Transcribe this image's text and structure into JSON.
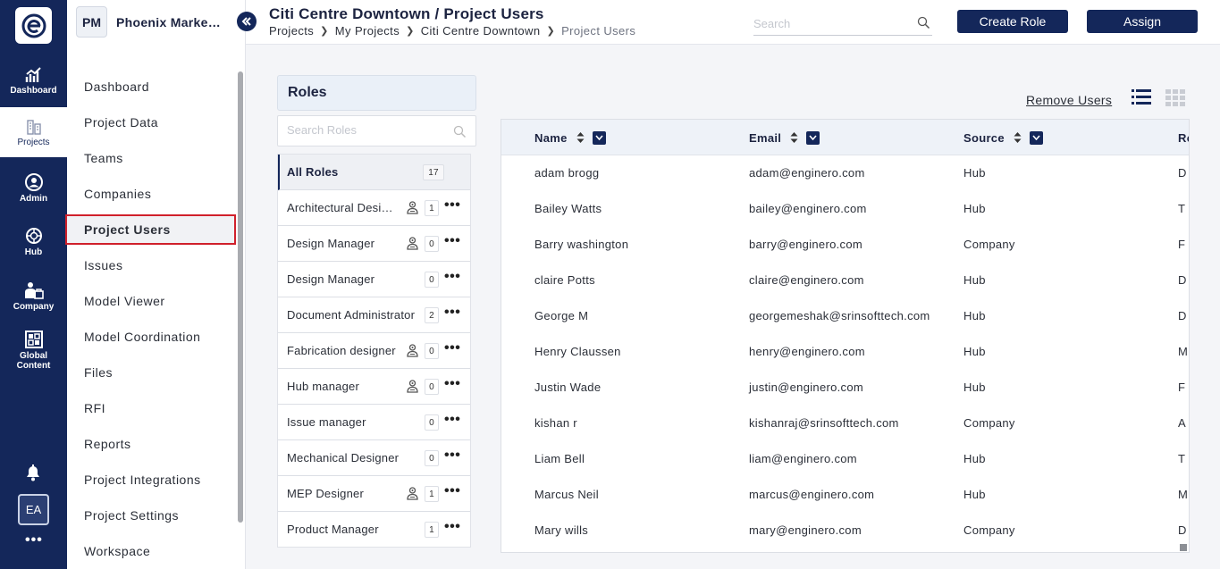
{
  "rail": {
    "items": [
      {
        "label": "Dashboard"
      },
      {
        "label": "Projects"
      },
      {
        "label": "Admin"
      },
      {
        "label": "Hub"
      },
      {
        "label": "Company"
      },
      {
        "label": "Global Content"
      }
    ],
    "avatar": "EA",
    "more": "•••"
  },
  "nav": {
    "project_initials": "PM",
    "project_name": "Phoenix Marketplace",
    "items": [
      {
        "label": "Dashboard"
      },
      {
        "label": "Project Data"
      },
      {
        "label": "Teams"
      },
      {
        "label": "Companies"
      },
      {
        "label": "Project Users"
      },
      {
        "label": "Issues"
      },
      {
        "label": "Model Viewer"
      },
      {
        "label": "Model Coordination"
      },
      {
        "label": "Files"
      },
      {
        "label": "RFI"
      },
      {
        "label": "Reports"
      },
      {
        "label": "Project Integrations"
      },
      {
        "label": "Project Settings"
      },
      {
        "label": "Workspace"
      }
    ]
  },
  "header": {
    "title": "Citi Centre Downtown / Project Users",
    "breadcrumbs": [
      "Projects",
      "My Projects",
      "Citi Centre Downtown",
      "Project Users"
    ],
    "search_placeholder": "Search",
    "create_role_label": "Create Role",
    "assign_label": "Assign"
  },
  "roles": {
    "title": "Roles",
    "search_placeholder": "Search Roles",
    "items": [
      {
        "name": "All Roles",
        "count": "17"
      },
      {
        "name": "Architectural Designer",
        "count": "1"
      },
      {
        "name": "Design Manager",
        "count": "0"
      },
      {
        "name": "Design Manager",
        "count": "0"
      },
      {
        "name": "Document Administrator",
        "count": "2"
      },
      {
        "name": "Fabrication designer",
        "count": "0"
      },
      {
        "name": "Hub manager",
        "count": "0"
      },
      {
        "name": "Issue manager",
        "count": "0"
      },
      {
        "name": "Mechanical Designer",
        "count": "0"
      },
      {
        "name": "MEP Designer",
        "count": "1"
      },
      {
        "name": "Product Manager",
        "count": "1"
      }
    ],
    "dots": "•••"
  },
  "users": {
    "remove_label": "Remove Users",
    "columns": [
      "Name",
      "Email",
      "Source",
      "Role"
    ],
    "rows": [
      {
        "name": "adam brogg",
        "email": "adam@enginero.com",
        "source": "Hub",
        "role": "D"
      },
      {
        "name": "Bailey Watts",
        "email": "bailey@enginero.com",
        "source": "Hub",
        "role": "T"
      },
      {
        "name": "Barry washington",
        "email": "barry@enginero.com",
        "source": "Company",
        "role": "F"
      },
      {
        "name": "claire Potts",
        "email": "claire@enginero.com",
        "source": "Hub",
        "role": "D"
      },
      {
        "name": "George M",
        "email": "georgemeshak@srinsofttech.com",
        "source": "Hub",
        "role": "D"
      },
      {
        "name": "Henry Claussen",
        "email": "henry@enginero.com",
        "source": "Hub",
        "role": "M"
      },
      {
        "name": "Justin Wade",
        "email": "justin@enginero.com",
        "source": "Hub",
        "role": "F"
      },
      {
        "name": "kishan r",
        "email": "kishanraj@srinsofttech.com",
        "source": "Company",
        "role": "A"
      },
      {
        "name": "Liam Bell",
        "email": "liam@enginero.com",
        "source": "Hub",
        "role": "T"
      },
      {
        "name": "Marcus Neil",
        "email": "marcus@enginero.com",
        "source": "Hub",
        "role": "M"
      },
      {
        "name": "Mary wills",
        "email": "mary@enginero.com",
        "source": "Company",
        "role": "D"
      }
    ]
  }
}
